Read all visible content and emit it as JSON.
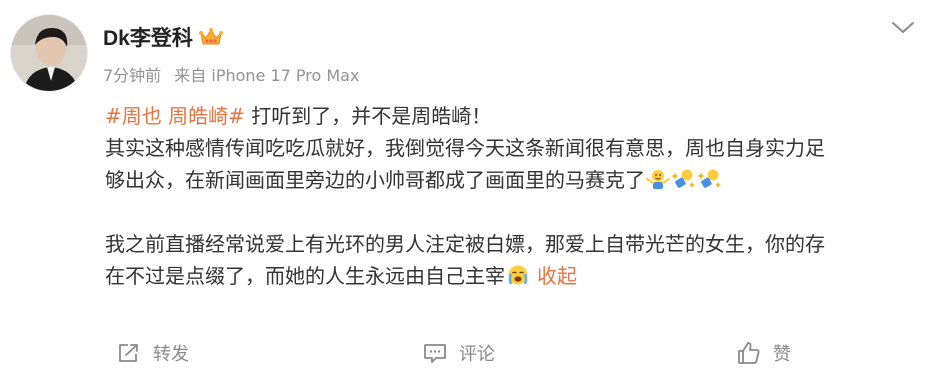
{
  "author": {
    "name": "Dk李登科",
    "badge_icon": "crown-icon"
  },
  "meta": {
    "time": "7分钟前",
    "source": "来自 iPhone 17 Pro Max"
  },
  "content": {
    "hashtag": "#周也 周皓崎#",
    "line1_text": " 打听到了，并不是周皓崎！",
    "line2": "其实这种感情传闻吃吃瓜就好，我倒觉得今天这条新闻很有意思，周也自身实力足",
    "line3": "够出众，在新闻画面里旁边的小帅哥都成了画面里的马赛克了",
    "line3_emojis": [
      "shrug-emoji",
      "sparkle-hug-emoji",
      "sparkle-hug-emoji"
    ],
    "line4": "我之前直播经常说爱上有光环的男人注定被白嫖，那爱上自带光芒的女生，你的存",
    "line5": "在不过是点缀了，而她的人生永远由自己主宰",
    "line5_emoji": "crying-emoji",
    "collapse_label": "收起"
  },
  "actions": {
    "repost_label": "转发",
    "comment_label": "评论",
    "like_label": "赞"
  },
  "colors": {
    "accent": "#eb7340",
    "text": "#333333",
    "muted": "#939393"
  }
}
